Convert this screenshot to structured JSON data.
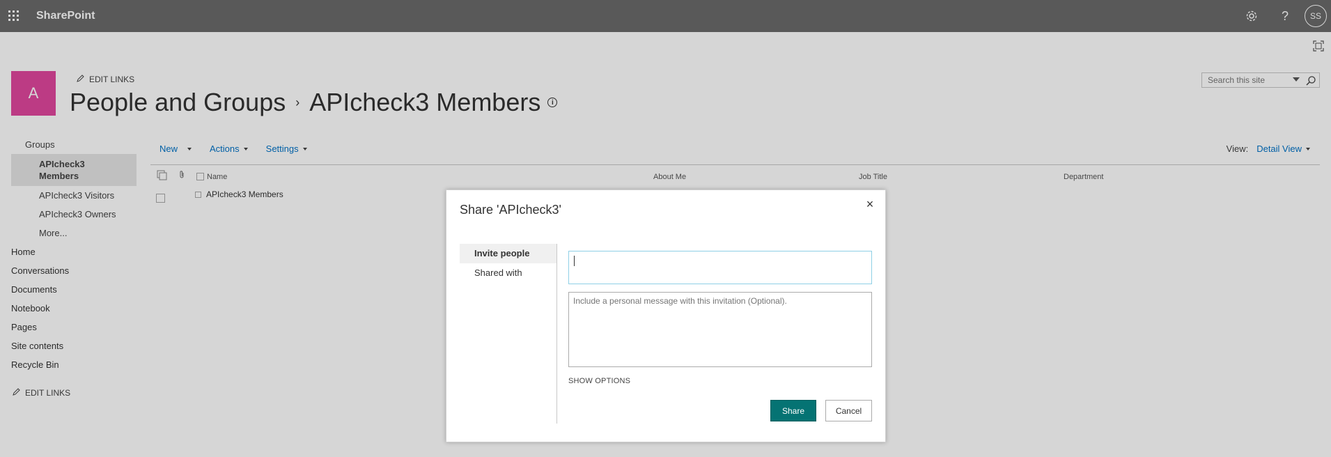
{
  "suitebar": {
    "app_name": "SharePoint",
    "settings_icon": "gear-icon",
    "help_label": "?",
    "user_initials": "SS"
  },
  "site": {
    "logo_letter": "A",
    "edit_links_label": "EDIT LINKS",
    "breadcrumb_root": "People and Groups",
    "breadcrumb_separator": "›",
    "breadcrumb_current": "APIcheck3 Members",
    "info_glyph": "i",
    "search_placeholder": "Search this site"
  },
  "leftnav": {
    "groups_header": "Groups",
    "group_items": [
      {
        "label": "APIcheck3 Members",
        "line1": "APIcheck3",
        "line2": "Members",
        "selected": true
      },
      {
        "label": "APIcheck3 Visitors",
        "selected": false
      },
      {
        "label": "APIcheck3 Owners",
        "selected": false
      },
      {
        "label": "More...",
        "selected": false
      }
    ],
    "items": [
      {
        "label": "Home"
      },
      {
        "label": "Conversations"
      },
      {
        "label": "Documents"
      },
      {
        "label": "Notebook"
      },
      {
        "label": "Pages"
      },
      {
        "label": "Site contents"
      },
      {
        "label": "Recycle Bin"
      }
    ],
    "edit_links_label": "EDIT LINKS"
  },
  "toolbar": {
    "new_label": "New",
    "actions_label": "Actions",
    "settings_label": "Settings",
    "view_label": "View:",
    "view_value": "Detail View"
  },
  "list": {
    "columns": [
      "Name",
      "About Me",
      "Job Title",
      "Department"
    ],
    "rows": [
      {
        "name": "APIcheck3 Members",
        "about": "",
        "job_title": "",
        "department": ""
      }
    ]
  },
  "dialog": {
    "title": "Share 'APIcheck3'",
    "close_glyph": "×",
    "tabs": [
      {
        "label": "Invite people",
        "active": true
      },
      {
        "label": "Shared with",
        "active": false
      }
    ],
    "people_input_value": "",
    "message_placeholder": "Include a personal message with this invitation (Optional).",
    "show_options_label": "SHOW OPTIONS",
    "share_label": "Share",
    "cancel_label": "Cancel"
  },
  "colors": {
    "suitebar": "#6a6a6a",
    "logo": "#e0479e",
    "accent": "#0072c6",
    "share_button": "#057373"
  }
}
